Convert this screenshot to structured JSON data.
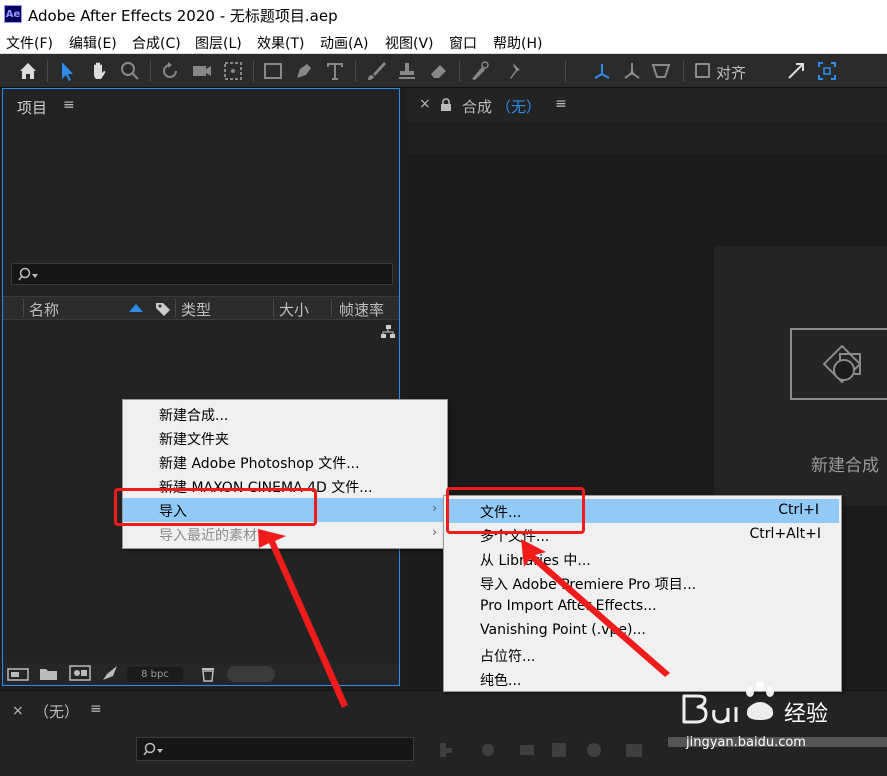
{
  "window": {
    "logo": "Ae",
    "title": "Adobe After Effects 2020 - 无标题项目.aep"
  },
  "menubar": [
    "文件(F)",
    "编辑(E)",
    "合成(C)",
    "图层(L)",
    "效果(T)",
    "动画(A)",
    "视图(V)",
    "窗口",
    "帮助(H)"
  ],
  "toolbar": {
    "align_label": "对齐"
  },
  "project": {
    "title": "项目",
    "menu_glyph": "≡",
    "columns": [
      "名称",
      "类型",
      "大小",
      "帧速率"
    ],
    "bpc": "8 bpc"
  },
  "composition": {
    "title": "合成",
    "value": "（无）",
    "close": "×",
    "menu_glyph": "≡",
    "new_comp": "新建合成"
  },
  "timeline": {
    "close": "×",
    "title": "（无）",
    "menu_glyph": "≡"
  },
  "context_menu": {
    "items": [
      {
        "label": "新建合成..."
      },
      {
        "label": "新建文件夹"
      },
      {
        "label": "新建 Adobe Photoshop 文件..."
      },
      {
        "label": "新建 MAXON CINEMA 4D 文件..."
      },
      {
        "label": "导入",
        "submenu": true,
        "highlighted": true
      },
      {
        "label": "导入最近的素材",
        "submenu": true,
        "disabled": true
      }
    ]
  },
  "import_submenu": {
    "items": [
      {
        "label": "文件...",
        "shortcut": "Ctrl+I",
        "highlighted": true
      },
      {
        "label": "多个文件...",
        "shortcut": "Ctrl+Alt+I"
      },
      {
        "label": "从 Libraries 中..."
      },
      {
        "label": "导入 Adobe Premiere Pro 项目..."
      },
      {
        "label": "Pro Import After Effects..."
      },
      {
        "label": "Vanishing Point (.vpe)..."
      },
      {
        "label": "占位符..."
      },
      {
        "label": "纯色..."
      }
    ]
  },
  "watermark": {
    "brand": "Bai 经验",
    "url": "jingyan.baidu.com"
  },
  "colors": {
    "accent": "#2d8ceb",
    "highlight": "#91c9f7",
    "annotation": "#f01b1b"
  }
}
